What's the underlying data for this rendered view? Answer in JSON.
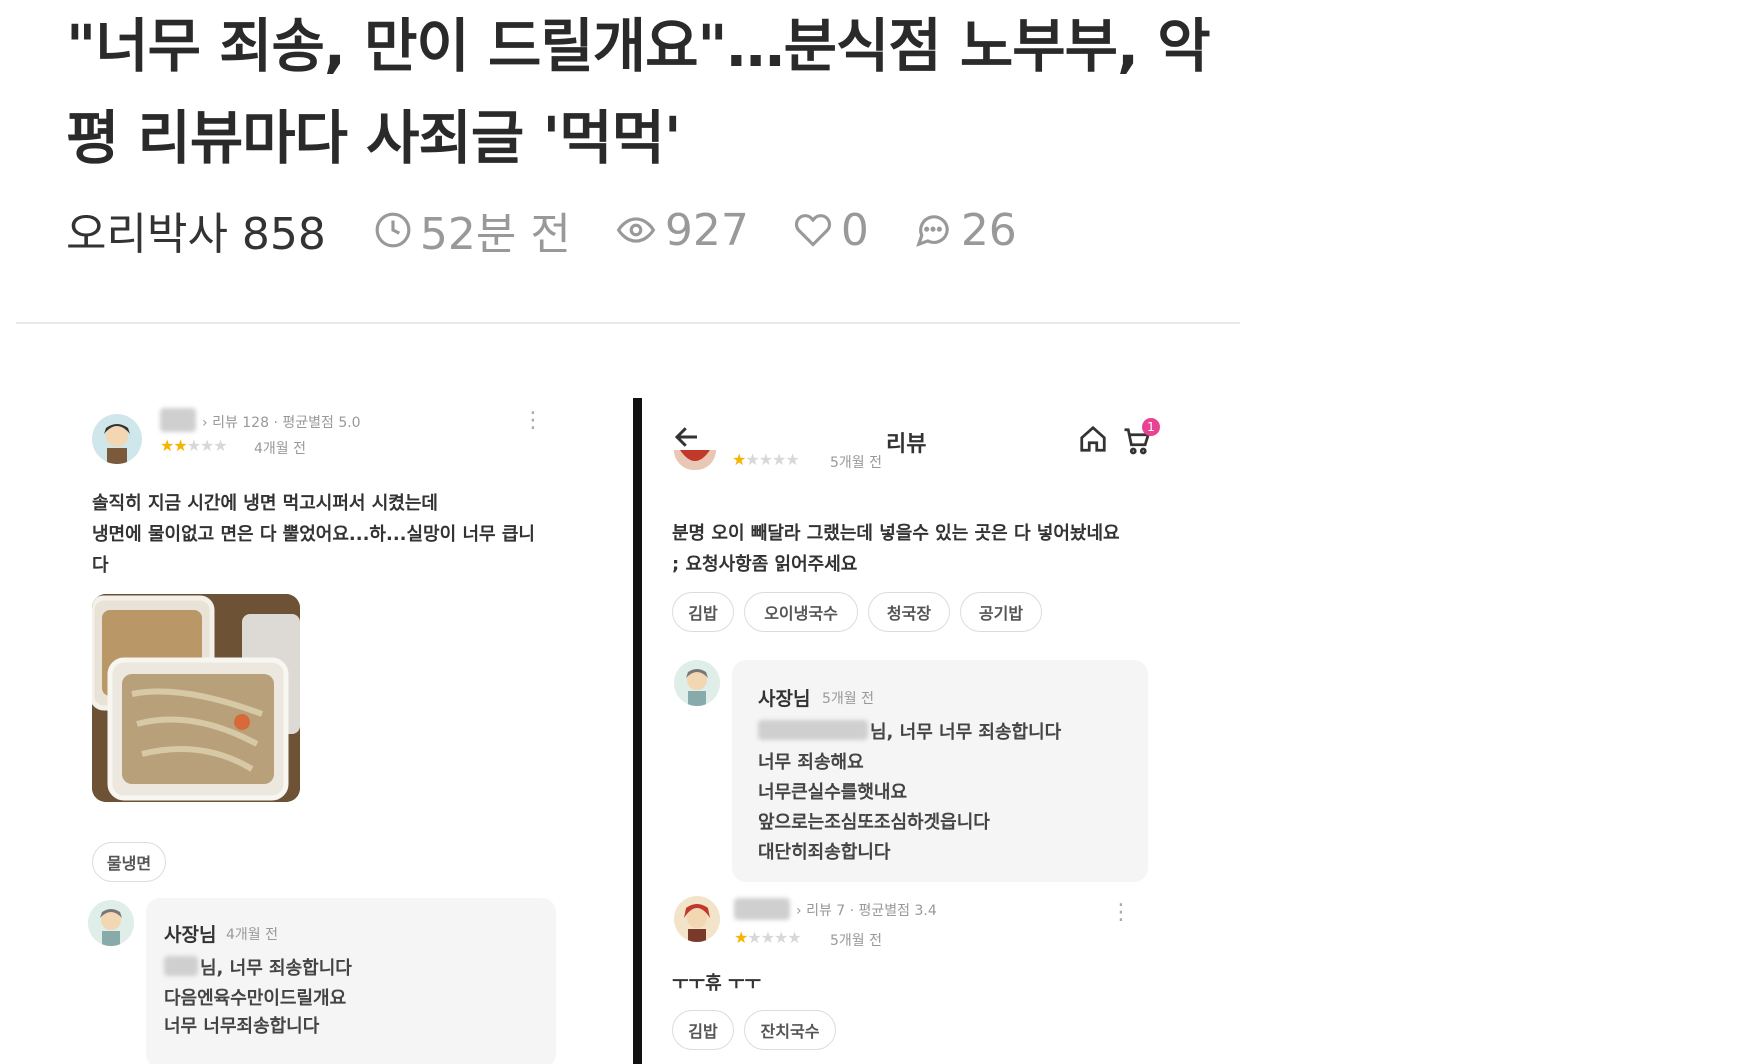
{
  "article": {
    "title": "\"너무 죄송, 만이 드릴개요\"…분식점 노부부, 악평 리뷰마다 사죄글 '먹먹'",
    "author": "오리박사 858",
    "time": "52분 전",
    "views": "927",
    "likes": "0",
    "comments": "26"
  },
  "left_review": {
    "meta": "리뷰 128 · 평균별점 5.0",
    "date": "4개월 전",
    "rating": 2,
    "text": "솔직히 지금 시간에 냉면 먹고시퍼서 시켰는데\n냉면에 물이없고 면은 다 뿔었어요...하...실망이 너무 큽니\n다",
    "chip": "물냉면",
    "reply": {
      "name": "사장님",
      "date": "4개월 전",
      "lines": [
        "님, 너무 죄송합니다",
        "다음엔육수만이드릴개요",
        "너무 너무죄송합니다"
      ]
    }
  },
  "right_screen": {
    "header_title": "리뷰",
    "cart_badge": "1",
    "review1": {
      "date": "5개월 전",
      "rating": 1,
      "text": "분명 오이 빼달라 그랬는데 넣을수 있는 곳은 다 넣어놨네요\n; 요청사항좀 읽어주세요",
      "chips": [
        "김밥",
        "오이냉국수",
        "청국장",
        "공기밥"
      ]
    },
    "reply": {
      "name": "사장님",
      "date": "5개월 전",
      "lines": [
        "님, 너무 너무 죄송합니다",
        "너무 죄송해요",
        "너무큰실수를햇내요",
        "앞으로는조심또조심하겟읍니다",
        "대단히죄송합니다"
      ]
    },
    "review2": {
      "meta": "리뷰 7 · 평균별점 3.4",
      "date": "5개월 전",
      "rating": 1,
      "text": "ㅜㅜ휴 ㅜㅜ",
      "chips": [
        "김밥",
        "잔치국수"
      ]
    }
  },
  "colors": {
    "star": "#f5b400",
    "badge": "#e84393",
    "muted": "#999999"
  }
}
